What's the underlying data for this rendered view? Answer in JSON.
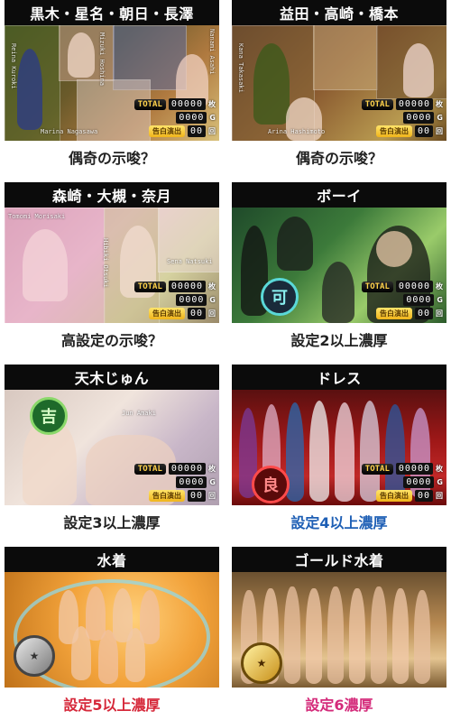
{
  "cards": [
    {
      "title": "黒木・星名・朝日・長澤",
      "caption": "偶奇の示唆？",
      "names": [
        "Reina Kuroki",
        "Nanami Asahi",
        "Marina Nagasawa",
        "Mizuki Hoshina"
      ]
    },
    {
      "title": "益田・高崎・橋本",
      "caption": "偶奇の示唆？",
      "names": [
        "Kana Takasaki",
        "Arina Hashimoto"
      ]
    },
    {
      "title": "森崎・大槻・奈月",
      "caption": "高設定の示唆？",
      "names": [
        "Tomomi Morisaki",
        "Sena Natsuki",
        "Hibiki Otsuki"
      ]
    },
    {
      "title": "ボーイ",
      "caption": "設定2以上濃厚",
      "badge": "可"
    },
    {
      "title": "天木じゅん",
      "caption": "設定3以上濃厚",
      "badge": "吉",
      "names": [
        "Jun Amaki"
      ]
    },
    {
      "title": "ドレス",
      "caption": "設定4以上濃厚",
      "badge": "良"
    },
    {
      "title": "水着",
      "caption": "設定5以上濃厚"
    },
    {
      "title": "ゴールド水着",
      "caption": "設定6濃厚"
    }
  ],
  "counter": {
    "total_label": "TOTAL",
    "total_value": "00000",
    "total_unit": "枚",
    "mid_value": "0000",
    "mid_unit": "G",
    "bonus_label": "告白演出",
    "bonus_value": "00",
    "bonus_unit": "回"
  },
  "colors": {
    "caption_default": "#222222",
    "caption_blue": "#1e5fb5",
    "caption_red": "#d6283a",
    "caption_pink": "#d42a7a"
  }
}
